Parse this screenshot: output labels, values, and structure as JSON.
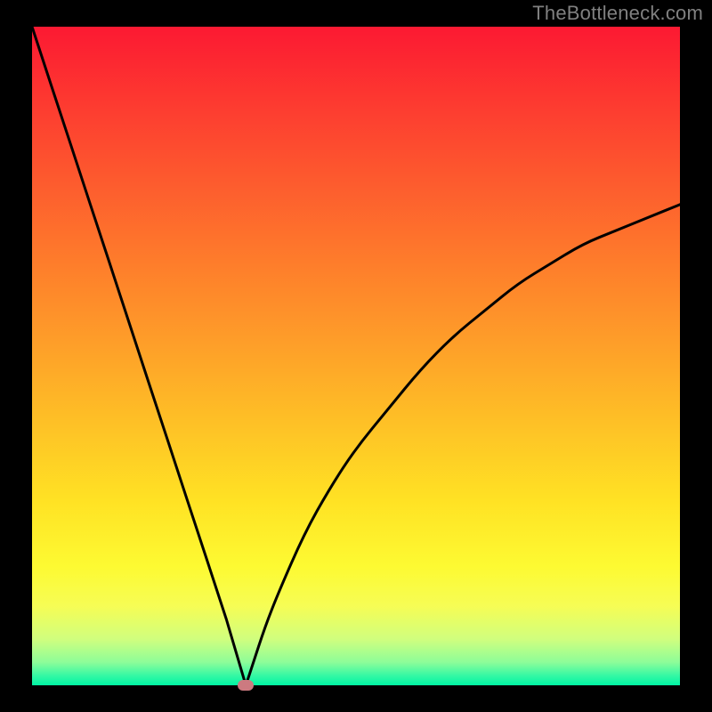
{
  "watermark": "TheBottleneck.com",
  "chart_data": {
    "type": "line",
    "title": "",
    "xlabel": "",
    "ylabel": "",
    "xlim": [
      0,
      100
    ],
    "ylim": [
      0,
      100
    ],
    "curve_min_x": 33,
    "curve": [
      {
        "x": 0,
        "y": 100
      },
      {
        "x": 3,
        "y": 91
      },
      {
        "x": 6,
        "y": 82
      },
      {
        "x": 9,
        "y": 73
      },
      {
        "x": 12,
        "y": 64
      },
      {
        "x": 15,
        "y": 55
      },
      {
        "x": 18,
        "y": 46
      },
      {
        "x": 21,
        "y": 37
      },
      {
        "x": 24,
        "y": 28
      },
      {
        "x": 27,
        "y": 19
      },
      {
        "x": 30,
        "y": 10
      },
      {
        "x": 33,
        "y": 0
      },
      {
        "x": 34,
        "y": 3
      },
      {
        "x": 36,
        "y": 9
      },
      {
        "x": 38,
        "y": 14
      },
      {
        "x": 42,
        "y": 23
      },
      {
        "x": 46,
        "y": 30
      },
      {
        "x": 50,
        "y": 36
      },
      {
        "x": 55,
        "y": 42
      },
      {
        "x": 60,
        "y": 48
      },
      {
        "x": 65,
        "y": 53
      },
      {
        "x": 70,
        "y": 57
      },
      {
        "x": 75,
        "y": 61
      },
      {
        "x": 80,
        "y": 64
      },
      {
        "x": 85,
        "y": 67
      },
      {
        "x": 90,
        "y": 69
      },
      {
        "x": 95,
        "y": 71
      },
      {
        "x": 100,
        "y": 73
      }
    ],
    "marker": {
      "x": 33,
      "y": 0
    },
    "colors": {
      "curve": "#000000",
      "bg_top": "#fc1932",
      "bg_bottom": "#00f4a4",
      "marker": "#cc7a80",
      "frame": "#000000"
    }
  }
}
